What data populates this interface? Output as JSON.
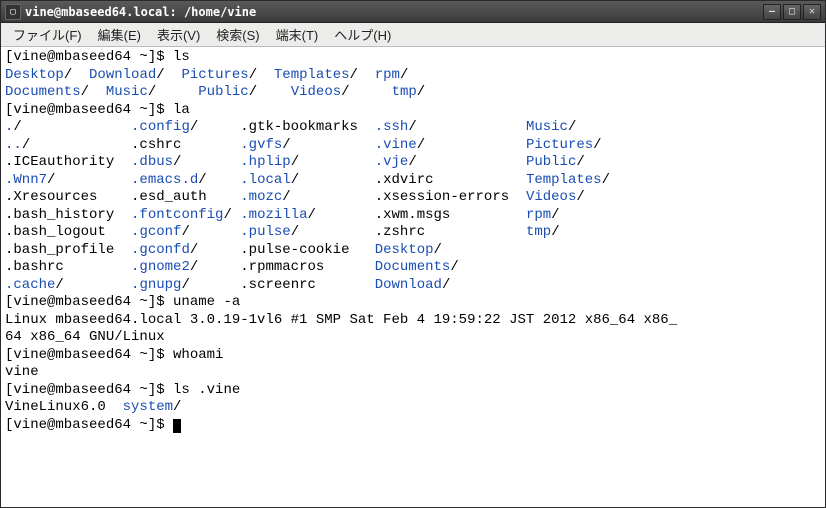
{
  "window": {
    "title": "vine@mbaseed64.local: /home/vine"
  },
  "menu": {
    "file": "ファイル(F)",
    "edit": "編集(E)",
    "view": "表示(V)",
    "search": "検索(S)",
    "terminal": "端末(T)",
    "help": "ヘルプ(H)"
  },
  "prompts": {
    "p": "[vine@mbaseed64 ~]$ "
  },
  "cmd": {
    "ls": "ls",
    "la": "la",
    "uname": "uname -a",
    "whoami": "whoami",
    "lsvine": "ls .vine"
  },
  "ls_out": {
    "c1r1": "Desktop",
    "c2r1": "Download",
    "c3r1": "Pictures",
    "c4r1": "Templates",
    "c5r1": "rpm",
    "c1r2": "Documents",
    "c2r2": "Music",
    "c3r2": "Public",
    "c4r2": "Videos",
    "c5r2": "tmp"
  },
  "la_out": {
    "r1c1": ".",
    "r1c2": ".config",
    "r1c3": ".gtk-bookmarks",
    "r1c4": ".ssh",
    "r1c5": "Music",
    "r2c1": "..",
    "r2c2": ".cshrc",
    "r2c3": ".gvfs",
    "r2c4": ".vine",
    "r2c5": "Pictures",
    "r3c1": ".ICEauthority",
    "r3c2": ".dbus",
    "r3c3": ".hplip",
    "r3c4": ".vje",
    "r3c5": "Public",
    "r4c1": ".Wnn7",
    "r4c2": ".emacs.d",
    "r4c3": ".local",
    "r4c4": ".xdvirc",
    "r4c5": "Templates",
    "r5c1": ".Xresources",
    "r5c2": ".esd_auth",
    "r5c3": ".mozc",
    "r5c4": ".xsession-errors",
    "r5c5": "Videos",
    "r6c1": ".bash_history",
    "r6c2": ".fontconfig",
    "r6c3": ".mozilla",
    "r6c4": ".xwm.msgs",
    "r6c5": "rpm",
    "r7c1": ".bash_logout",
    "r7c2": ".gconf",
    "r7c3": ".pulse",
    "r7c4": ".zshrc",
    "r7c5": "tmp",
    "r8c1": ".bash_profile",
    "r8c2": ".gconfd",
    "r8c3": ".pulse-cookie",
    "r8c4": "Desktop",
    "r9c1": ".bashrc",
    "r9c2": ".gnome2",
    "r9c3": ".rpmmacros",
    "r9c4": "Documents",
    "r10c1": ".cache",
    "r10c2": ".gnupg",
    "r10c3": ".screenrc",
    "r10c4": "Download"
  },
  "uname_out": "Linux mbaseed64.local 3.0.19-1vl6 #1 SMP Sat Feb 4 19:59:22 JST 2012 x86_64 x86_\n64 x86_64 GNU/Linux",
  "whoami_out": "vine",
  "lsvine_out": {
    "a": "VineLinux6.0  ",
    "b": "system"
  },
  "slash": "/"
}
